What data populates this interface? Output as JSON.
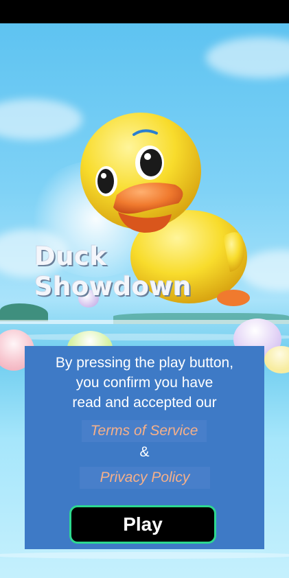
{
  "game": {
    "title_line1": "Duck",
    "title_line2": "Showdown",
    "mascot": "rubber-duck"
  },
  "terms": {
    "line1": "By pressing the play button,",
    "line2": "you confirm you have",
    "line3": "read and accepted our",
    "terms_link": "Terms of Service",
    "separator": "&",
    "privacy_link": "Privacy Policy",
    "play_label": "Play"
  },
  "colors": {
    "panel": "#3e7ac6",
    "link": "#f5b08a",
    "play_border": "#2dd88f",
    "duck": "#f8dc2c",
    "beak": "#f07a2e"
  }
}
